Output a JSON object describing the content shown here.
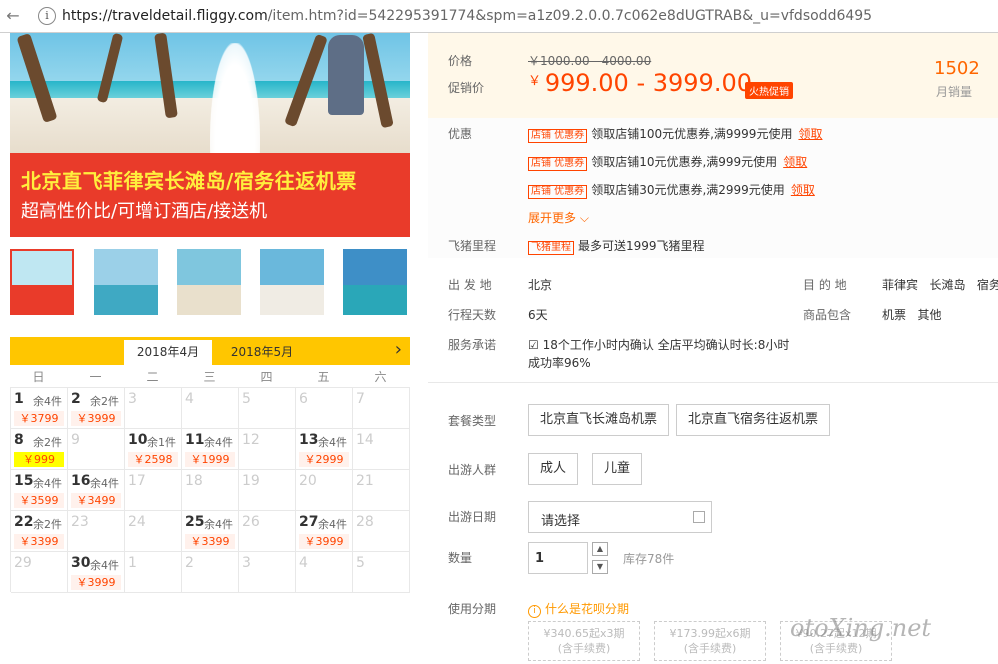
{
  "browser": {
    "url_host": "https://traveldetail.fliggy.com",
    "url_rest": "/item.htm?id=542295391774&spm=a1z09.2.0.0.7c062e8dUGTRAB&_u=vfdsodd6495"
  },
  "banner": {
    "line1": "北京直飞菲律宾长滩岛/宿务往返机票",
    "line2": "超高性价比/可增订酒店/接送机"
  },
  "calendar": {
    "tabs": [
      "2018年4月",
      "2018年5月"
    ],
    "weekdays": [
      "日",
      "一",
      "二",
      "三",
      "四",
      "五",
      "六"
    ],
    "rows": [
      [
        {
          "d": "1",
          "s": "余4件",
          "p": "￥3799"
        },
        {
          "d": "2",
          "s": "余2件",
          "p": "￥3999"
        },
        {
          "d": "3"
        },
        {
          "d": "4"
        },
        {
          "d": "5"
        },
        {
          "d": "6"
        },
        {
          "d": "7"
        }
      ],
      [
        {
          "d": "8",
          "s": "余2件",
          "p": "￥999",
          "hl": true
        },
        {
          "d": "9"
        },
        {
          "d": "10",
          "s": "余1件",
          "p": "￥2598"
        },
        {
          "d": "11",
          "s": "余4件",
          "p": "￥1999"
        },
        {
          "d": "12"
        },
        {
          "d": "13",
          "s": "余4件",
          "p": "￥2999"
        },
        {
          "d": "14"
        }
      ],
      [
        {
          "d": "15",
          "s": "余4件",
          "p": "￥3599"
        },
        {
          "d": "16",
          "s": "余4件",
          "p": "￥3499"
        },
        {
          "d": "17"
        },
        {
          "d": "18"
        },
        {
          "d": "19"
        },
        {
          "d": "20"
        },
        {
          "d": "21"
        }
      ],
      [
        {
          "d": "22",
          "s": "余2件",
          "p": "￥3399"
        },
        {
          "d": "23"
        },
        {
          "d": "24"
        },
        {
          "d": "25",
          "s": "余4件",
          "p": "￥3399"
        },
        {
          "d": "26"
        },
        {
          "d": "27",
          "s": "余4件",
          "p": "￥3999"
        },
        {
          "d": "28"
        }
      ],
      [
        {
          "d": "29"
        },
        {
          "d": "30",
          "s": "余4件",
          "p": "￥3999"
        },
        {
          "d": "1"
        },
        {
          "d": "2"
        },
        {
          "d": "3"
        },
        {
          "d": "4"
        },
        {
          "d": "5"
        }
      ]
    ]
  },
  "price": {
    "label_price": "价格",
    "original": "￥1000.00 - 4000.00",
    "label_promo": "促销价",
    "currency": "￥",
    "promo": "999.00 - 3999.00",
    "hot_tag": "火热促销",
    "sales_count": "1502",
    "sales_label": "月销量"
  },
  "promos": {
    "label": "优惠",
    "tag": "店铺 优惠券",
    "coupons": [
      "领取店铺100元优惠券,满9999元使用",
      "领取店铺10元优惠券,满999元使用",
      "领取店铺30元优惠券,满2999元使用"
    ],
    "claim": "领取",
    "more": "展开更多 ⌵",
    "miles_label": "飞猪里程",
    "miles_tag": "飞猪里程",
    "miles_text": "最多可送1999飞猪里程"
  },
  "info": {
    "depart_label": "出 发 地",
    "depart": "北京",
    "dest_label": "目 的 地",
    "dest": "菲律宾   长滩岛   宿务",
    "days_label": "行程天数",
    "days": "6天",
    "includes_label": "商品包含",
    "includes": "机票   其他",
    "service_label": "服务承诺",
    "service_line1": "18个工作小时内确认 全店平均确认时长:8小时",
    "service_line2": "成功率96%"
  },
  "options": {
    "package_label": "套餐类型",
    "packages": [
      "北京直飞长滩岛机票",
      "北京直飞宿务往返机票"
    ],
    "traveler_label": "出游人群",
    "travelers": [
      "成人",
      "儿童"
    ],
    "date_label": "出游日期",
    "date_placeholder": "请选择",
    "qty_label": "数量",
    "qty": "1",
    "stock": "库存78件",
    "installment_label": "使用分期",
    "huabei": "什么是花呗分期",
    "installments": [
      {
        "a": "¥340.65起x3期",
        "b": "(含手续费)"
      },
      {
        "a": "¥173.99起x6期",
        "b": "(含手续费)"
      },
      {
        "a": "¥90.27起x12期",
        "b": "(含手续费)"
      }
    ]
  },
  "watermark": "otoXing.net",
  "colors": {
    "accent": "#ff4400",
    "banner": "#e93b2a",
    "calendar_bar": "#ffc600"
  }
}
